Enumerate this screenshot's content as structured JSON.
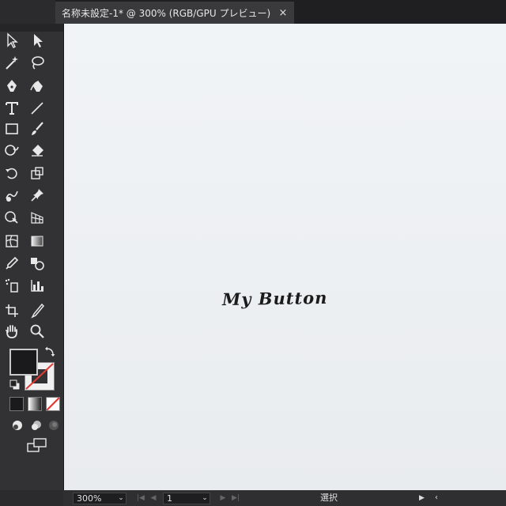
{
  "document_tab": {
    "title": "名称未設定-1* @ 300% (RGB/GPU プレビュー)",
    "close_glyph": "×"
  },
  "tools": [
    {
      "name": "selection-tool",
      "icon": "arrow-outline-icon"
    },
    {
      "name": "direct-selection-tool",
      "icon": "arrow-solid-icon"
    },
    {
      "name": "magic-wand-tool",
      "icon": "magic-wand-icon"
    },
    {
      "name": "lasso-tool",
      "icon": "lasso-icon"
    },
    {
      "name": "pen-tool",
      "icon": "pen-icon"
    },
    {
      "name": "curvature-tool",
      "icon": "curvature-pen-icon"
    },
    {
      "name": "type-tool",
      "icon": "type-icon"
    },
    {
      "name": "line-segment-tool",
      "icon": "line-icon"
    },
    {
      "name": "rectangle-tool",
      "icon": "rectangle-icon"
    },
    {
      "name": "paintbrush-tool",
      "icon": "brush-icon"
    },
    {
      "name": "shaper-tool",
      "icon": "shaper-icon"
    },
    {
      "name": "eraser-tool",
      "icon": "eraser-icon"
    },
    {
      "name": "rotate-tool",
      "icon": "rotate-icon"
    },
    {
      "name": "scale-tool",
      "icon": "scale-icon"
    },
    {
      "name": "warp-tool",
      "icon": "warp-icon"
    },
    {
      "name": "puppet-warp-tool",
      "icon": "pin-icon"
    },
    {
      "name": "shape-builder-tool",
      "icon": "shape-builder-icon"
    },
    {
      "name": "perspective-grid-tool",
      "icon": "perspective-grid-icon"
    },
    {
      "name": "mesh-tool",
      "icon": "mesh-icon"
    },
    {
      "name": "gradient-tool",
      "icon": "gradient-icon"
    },
    {
      "name": "eyedropper-tool",
      "icon": "eyedropper-icon"
    },
    {
      "name": "blend-tool",
      "icon": "blend-icon"
    },
    {
      "name": "symbol-sprayer-tool",
      "icon": "symbol-sprayer-icon"
    },
    {
      "name": "column-graph-tool",
      "icon": "bar-graph-icon"
    },
    {
      "name": "artboard-tool",
      "icon": "artboard-icon"
    },
    {
      "name": "slice-tool",
      "icon": "slice-icon"
    },
    {
      "name": "hand-tool",
      "icon": "hand-icon"
    },
    {
      "name": "zoom-tool",
      "icon": "magnifier-icon"
    }
  ],
  "colors": {
    "fill": "#1a1a1d",
    "stroke": "#f0f0f0",
    "none_slash": "#e53935",
    "canvas": "#eef1f3",
    "panel": "#323234"
  },
  "canvas": {
    "text": "My Button"
  },
  "status_bar": {
    "zoom": "300%",
    "page": "1",
    "tool_label": "選択",
    "zoom_arrow": "⌄",
    "page_arrow": "⌄",
    "first": "|◀",
    "prev": "◀",
    "next": "▶",
    "last": "▶|",
    "play": "▶",
    "collapse": "‹"
  }
}
